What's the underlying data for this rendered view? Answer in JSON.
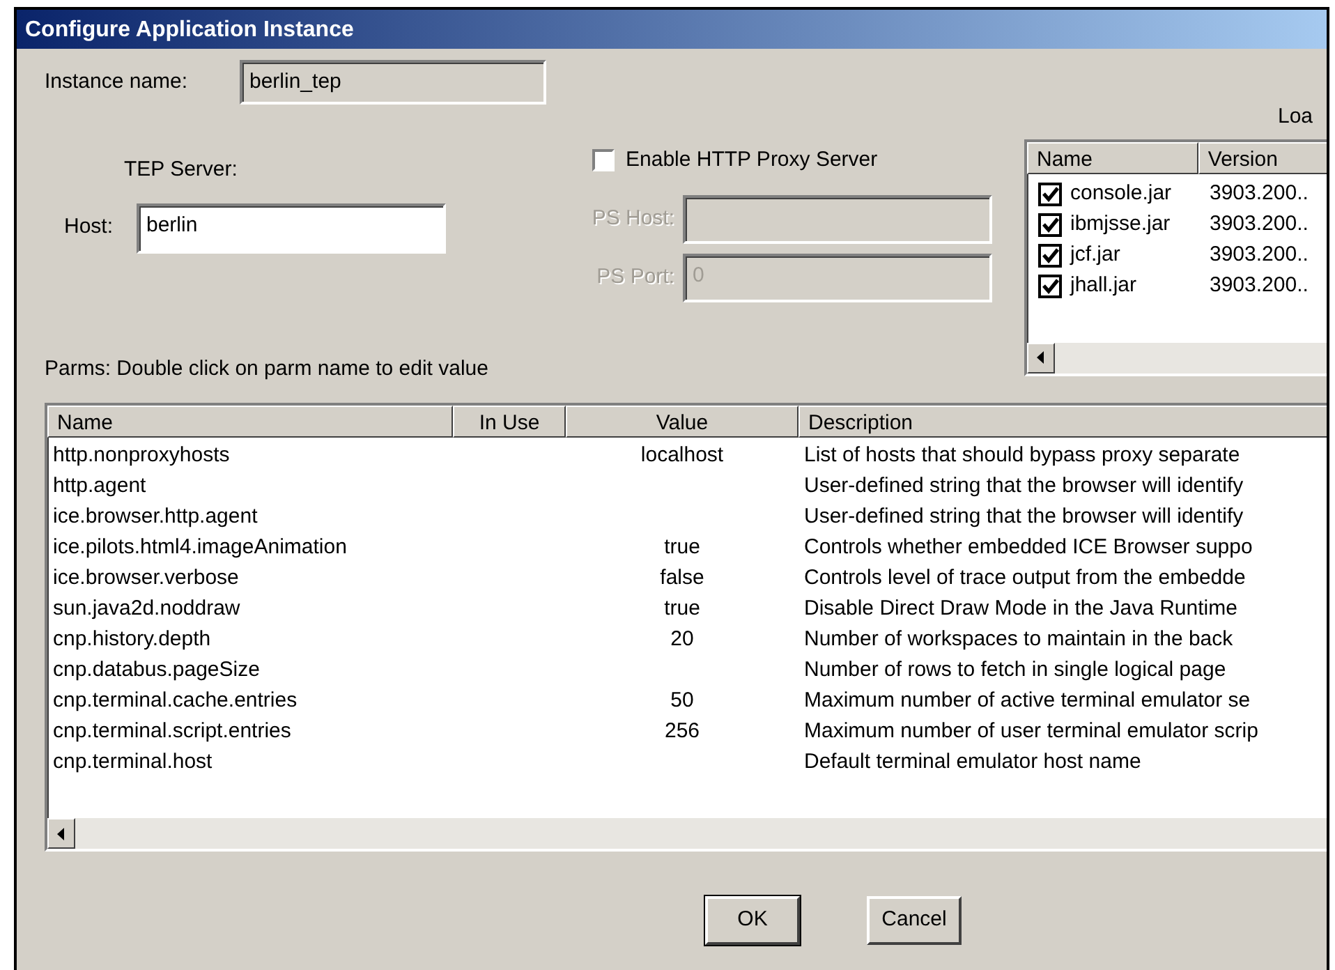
{
  "window": {
    "title": "Configure Application Instance"
  },
  "instance": {
    "label": "Instance name:",
    "value": "berlin_tep",
    "disabled": true
  },
  "tep_server": {
    "label": "TEP Server:",
    "host_label": "Host:",
    "host_value": "berlin"
  },
  "proxy": {
    "label": "Enable HTTP Proxy Server",
    "checked": false,
    "fields": [
      {
        "label": "PS Host:",
        "disabled": true
      },
      {
        "label": "PS Port:",
        "value": "0",
        "disabled": true
      }
    ]
  },
  "jars": {
    "label": "Loa",
    "columns": [
      "Name",
      "Version"
    ],
    "rows": [
      {
        "name": "console.jar",
        "version": "3903.200..",
        "checked": true
      },
      {
        "name": "ibmjsse.jar",
        "version": "3903.200..",
        "checked": true
      },
      {
        "name": "jcf.jar",
        "version": "3903.200..",
        "checked": true
      },
      {
        "name": "jhall.jar",
        "version": "3903.200..",
        "checked": true
      }
    ]
  },
  "parms": {
    "label": "Parms: Double click on parm name to edit value",
    "columns": [
      "Name",
      "In Use",
      "Value",
      "Description"
    ],
    "rows": [
      {
        "name": "http.nonproxyhosts",
        "value": "localhost",
        "description": "List of hosts that should bypass proxy separate"
      },
      {
        "name": "http.agent",
        "description": "User-defined string that the browser will identify"
      },
      {
        "name": "ice.browser.http.agent",
        "description": "User-defined string that the browser will identify"
      },
      {
        "name": "ice.pilots.html4.imageAnimation",
        "value": "true",
        "description": "Controls whether embedded ICE Browser suppo"
      },
      {
        "name": "ice.browser.verbose",
        "value": "false",
        "description": "Controls level of trace output from the embedde"
      },
      {
        "name": "sun.java2d.noddraw",
        "value": "true",
        "description": "Disable Direct Draw Mode in the Java Runtime"
      },
      {
        "name": "cnp.history.depth",
        "value": "20",
        "description": "Number of workspaces to maintain in the back"
      },
      {
        "name": "cnp.databus.pageSize",
        "description": "Number of rows to fetch in single logical page"
      },
      {
        "name": "cnp.terminal.cache.entries",
        "value": "50",
        "description": "Maximum number of active terminal emulator se"
      },
      {
        "name": "cnp.terminal.script.entries",
        "value": "256",
        "description": "Maximum number of user terminal emulator scrip"
      },
      {
        "name": "cnp.terminal.host",
        "description": "Default terminal emulator host name"
      }
    ]
  },
  "buttons": [
    {
      "label": "OK",
      "default": true
    },
    {
      "label": "Cancel",
      "default": false
    }
  ]
}
